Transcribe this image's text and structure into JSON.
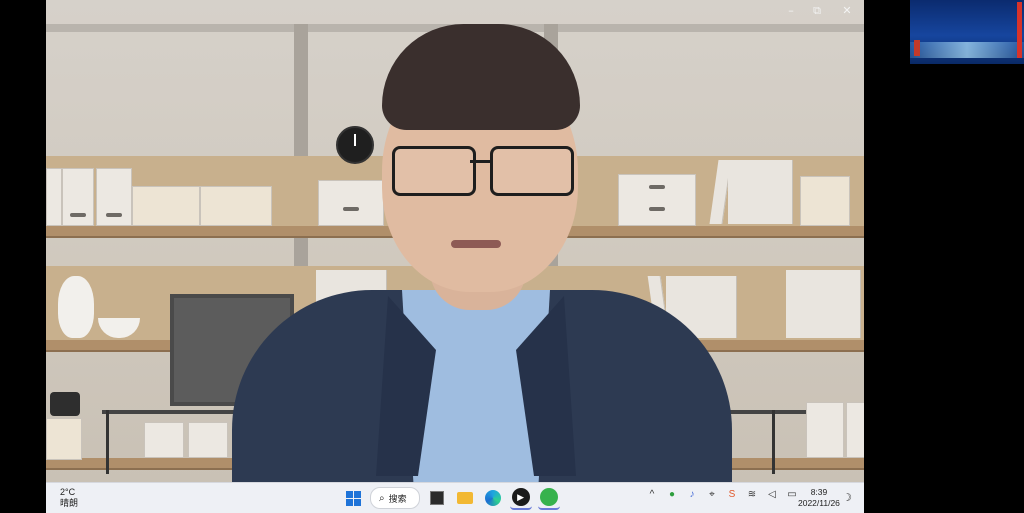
{
  "window": {
    "controls": {
      "minimize": "–",
      "maximize": "⧉",
      "close": "✕"
    }
  },
  "taskbar": {
    "weather": {
      "temperature": "2°C",
      "condition": "晴朗"
    },
    "search": {
      "icon": "search-icon",
      "label": "搜索"
    },
    "pinned": [
      "start-icon",
      "search-icon",
      "task-view-icon",
      "file-explorer-icon",
      "edge-icon",
      "media-player-icon",
      "wechat-icon"
    ],
    "tray": [
      "chevron-up-icon",
      "360-icon",
      "microphone-icon",
      "network-icon",
      "app-icon",
      "wifi-icon",
      "volume-icon",
      "battery-icon"
    ],
    "clock": {
      "time": "8:39",
      "date": "2022/11/26"
    }
  },
  "colors": {
    "taskbar_bg": "#eef0f5",
    "accent": "#1e73d8",
    "jacket": "#2d3a52",
    "shirt": "#9fbde0"
  }
}
